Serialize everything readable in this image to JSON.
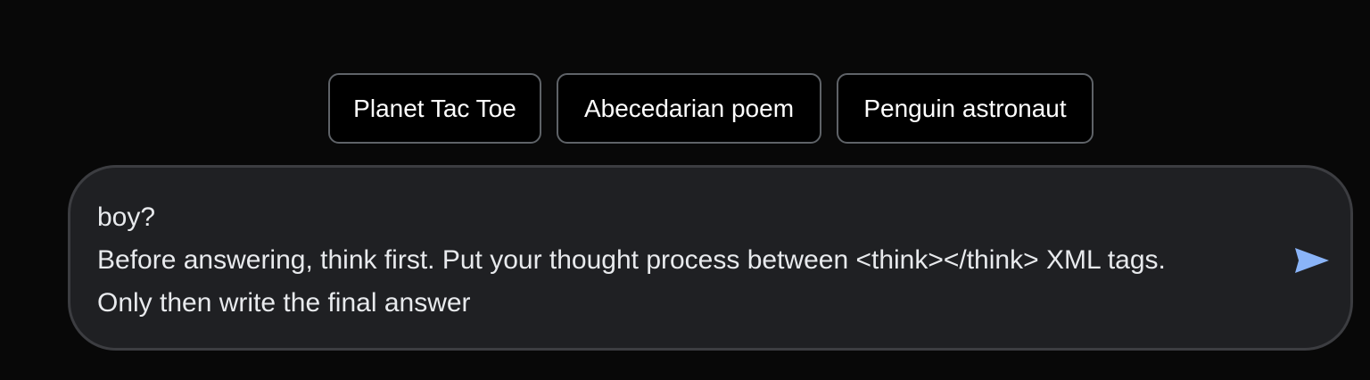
{
  "suggestions": [
    {
      "label": "Planet Tac Toe"
    },
    {
      "label": "Abecedarian poem"
    },
    {
      "label": "Penguin astronaut"
    }
  ],
  "prompt": {
    "value": "boy?\nBefore answering, think first. Put your thought process between <think></think> XML tags.\nOnly then write the final answer"
  },
  "icons": {
    "send": "send-icon"
  },
  "colors": {
    "background": "#080808",
    "chip_border": "#5f6368",
    "composer_background": "#1f2023",
    "composer_border": "#3c3d41",
    "send_icon": "#8ab4f8"
  }
}
